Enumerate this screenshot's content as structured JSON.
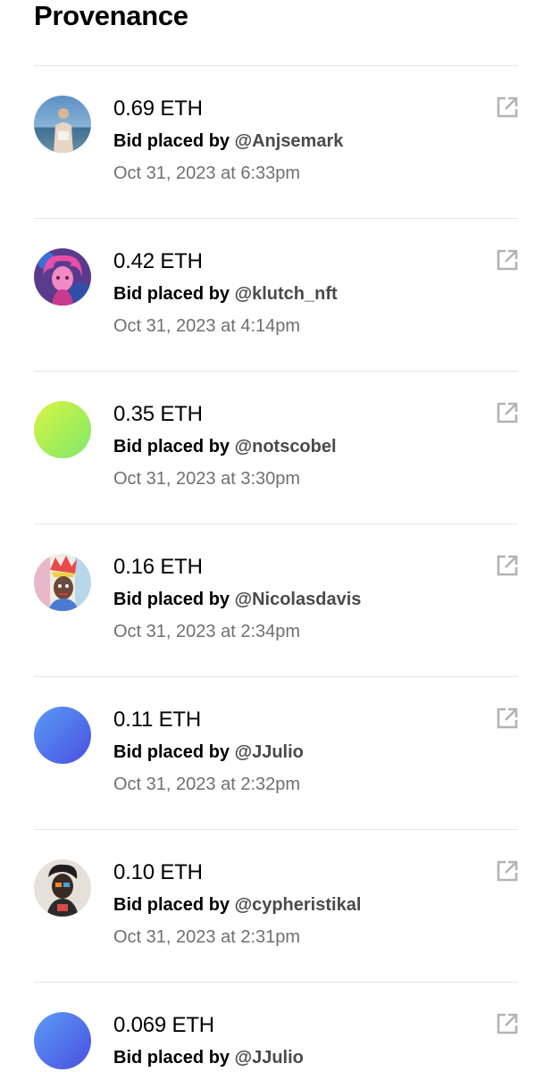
{
  "title": "Provenance",
  "bid_prefix": "Bid placed by",
  "entries": [
    {
      "amount": "0.69 ETH",
      "user": "@Anjsemark",
      "date": "Oct 31, 2023 at 6:33pm",
      "avatar": "photo-man-beach"
    },
    {
      "amount": "0.42 ETH",
      "user": "@klutch_nft",
      "date": "Oct 31, 2023 at 4:14pm",
      "avatar": "pink-hair-character"
    },
    {
      "amount": "0.35 ETH",
      "user": "@notscobel",
      "date": "Oct 31, 2023 at 3:30pm",
      "avatar": "lime-gradient"
    },
    {
      "amount": "0.16 ETH",
      "user": "@Nicolasdavis",
      "date": "Oct 31, 2023 at 2:34pm",
      "avatar": "colorful-art-face"
    },
    {
      "amount": "0.11 ETH",
      "user": "@JJulio",
      "date": "Oct 31, 2023 at 2:32pm",
      "avatar": "blue-gradient"
    },
    {
      "amount": "0.10 ETH",
      "user": "@cypheristikal",
      "date": "Oct 31, 2023 at 2:31pm",
      "avatar": "dark-art-character"
    },
    {
      "amount": "0.069 ETH",
      "user": "@JJulio",
      "date": "",
      "avatar": "blue-gradient"
    }
  ],
  "colors": {
    "divider": "#e6e6e6",
    "username": "#4a4a4a",
    "date": "#707070",
    "icon": "#b3b3b3"
  },
  "icons": {
    "external_link": "external-link-icon"
  }
}
